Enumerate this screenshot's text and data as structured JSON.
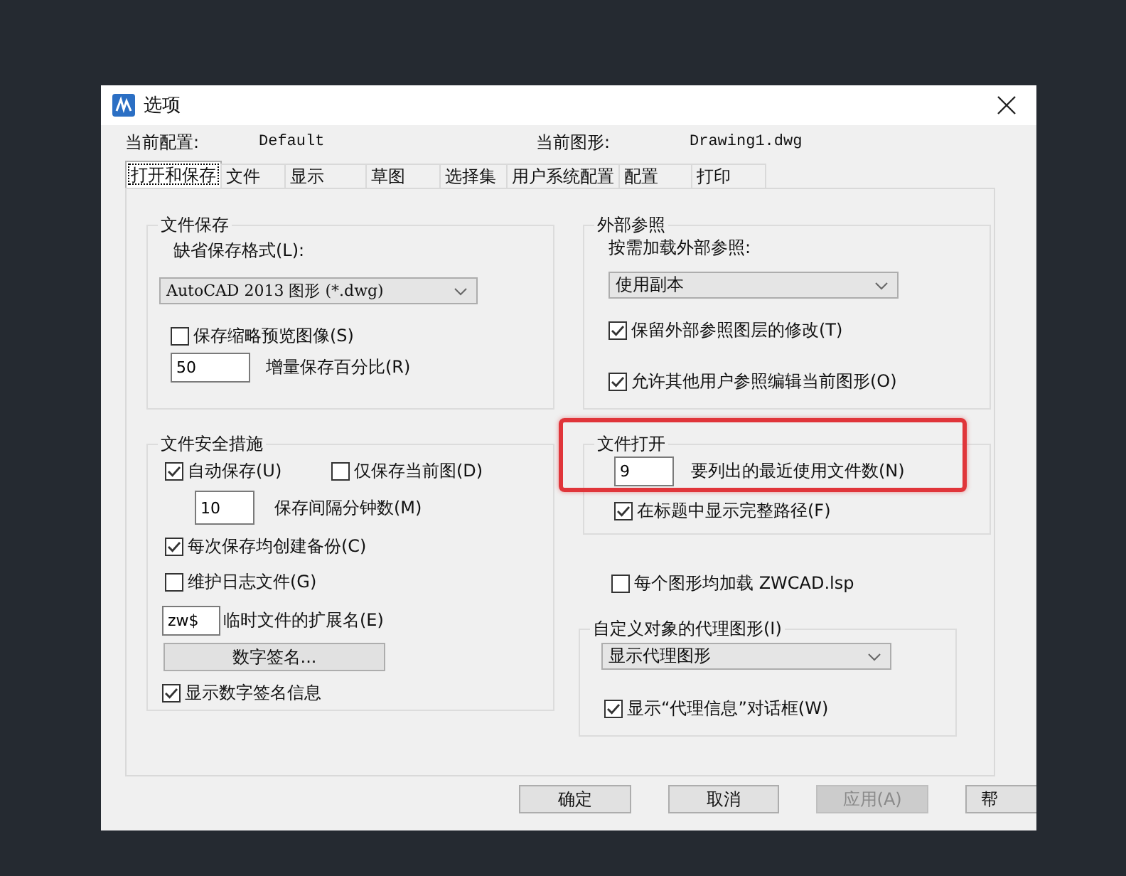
{
  "window": {
    "title": "选项"
  },
  "header": {
    "profile_label": "当前配置:",
    "profile": "Default",
    "drawing_label": "当前图形:",
    "drawing": "Drawing1.dwg"
  },
  "tabs": [
    {
      "label": "打开和保存",
      "selected": true
    },
    {
      "label": "文件",
      "selected": false
    },
    {
      "label": "显示",
      "selected": false
    },
    {
      "label": "草图",
      "selected": false
    },
    {
      "label": "选择集",
      "selected": false
    },
    {
      "label": "用户系统配置",
      "selected": false
    },
    {
      "label": "配置",
      "selected": false
    },
    {
      "label": "打印",
      "selected": false
    }
  ],
  "file_save": {
    "title": "文件保存",
    "format_label": "缺省保存格式(L):",
    "format": "AutoCAD 2013 图形 (*.dwg)",
    "thumbnail": {
      "label": "保存缩略预览图像(S)",
      "checked": false
    },
    "incremental": {
      "value": "50",
      "label": "增量保存百分比(R)"
    }
  },
  "file_safety": {
    "title": "文件安全措施",
    "autosave": {
      "label": "自动保存(U)",
      "checked": true
    },
    "current_only": {
      "label": "仅保存当前图(D)",
      "checked": false
    },
    "interval": {
      "value": "10",
      "label": "保存间隔分钟数(M)"
    },
    "backup": {
      "label": "每次保存均创建备份(C)",
      "checked": true
    },
    "log": {
      "label": "维护日志文件(G)",
      "checked": false
    },
    "temp_ext": {
      "value": "zw$",
      "label": "临时文件的扩展名(E)"
    },
    "signature_button": "数字签名...",
    "show_signature": {
      "label": "显示数字签名信息",
      "checked": true
    }
  },
  "xref": {
    "title": "外部参照",
    "load_label": "按需加载外部参照:",
    "load_value": "使用副本",
    "retain": {
      "label": "保留外部参照图层的修改(T)",
      "checked": true
    },
    "allow": {
      "label": "允许其他用户参照编辑当前图形(O)",
      "checked": true
    }
  },
  "file_open": {
    "title": "文件打开",
    "highlighted": true,
    "recent": {
      "value": "9",
      "label": "要列出的最近使用文件数(N)"
    },
    "full_path": {
      "label": "在标题中显示完整路径(F)",
      "checked": true
    }
  },
  "load_lsp": {
    "label": "每个图形均加载 ZWCAD.lsp",
    "checked": false
  },
  "proxy": {
    "title": "自定义对象的代理图形(I)",
    "value": "显示代理图形",
    "show_dialog": {
      "label": "显示“代理信息”对话框(W)",
      "checked": true
    }
  },
  "buttons": [
    {
      "label": "确定",
      "disabled": false
    },
    {
      "label": "取消",
      "disabled": false
    },
    {
      "label": "应用(A)",
      "disabled": true
    },
    {
      "label": "帮",
      "disabled": false
    }
  ]
}
